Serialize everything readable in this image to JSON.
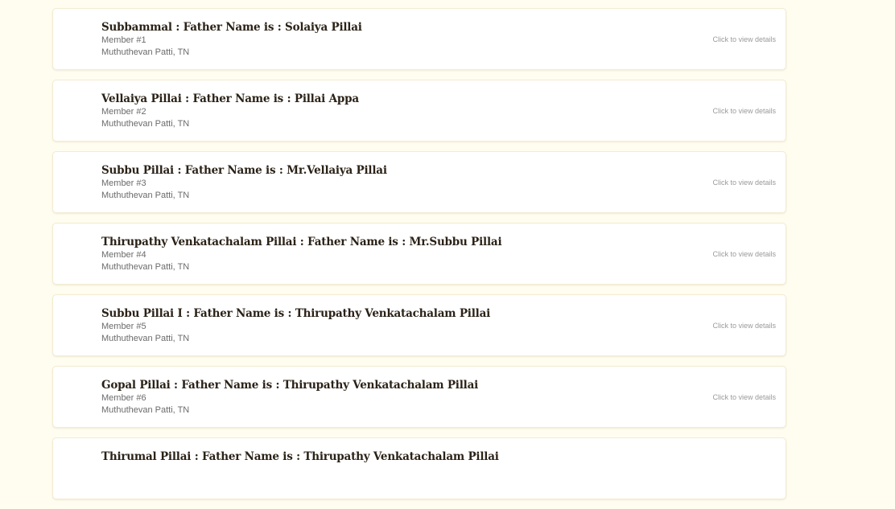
{
  "members": [
    {
      "title": "Subbammal : Father Name is : Solaiya Pillai",
      "number": "Member #1",
      "location": "Muthuthevan Patti, TN",
      "cta": "Click to view details"
    },
    {
      "title": "Vellaiya Pillai : Father Name is : Pillai Appa",
      "number": "Member #2",
      "location": "Muthuthevan Patti, TN",
      "cta": "Click to view details"
    },
    {
      "title": "Subbu Pillai : Father Name is : Mr.Vellaiya Pillai",
      "number": "Member #3",
      "location": "Muthuthevan Patti, TN",
      "cta": "Click to view details"
    },
    {
      "title": "Thirupathy Venkatachalam Pillai : Father Name is : Mr.Subbu Pillai",
      "number": "Member #4",
      "location": "Muthuthevan Patti, TN",
      "cta": "Click to view details"
    },
    {
      "title": "Subbu Pillai I : Father Name is : Thirupathy Venkatachalam Pillai",
      "number": "Member #5",
      "location": "Muthuthevan Patti, TN",
      "cta": "Click to view details"
    },
    {
      "title": "Gopal Pillai : Father Name is : Thirupathy Venkatachalam Pillai",
      "number": "Member #6",
      "location": "Muthuthevan Patti, TN",
      "cta": "Click to view details"
    },
    {
      "title": "Thirumal Pillai : Father Name is : Thirupathy Venkatachalam Pillai",
      "number": "",
      "location": "",
      "cta": ""
    }
  ]
}
